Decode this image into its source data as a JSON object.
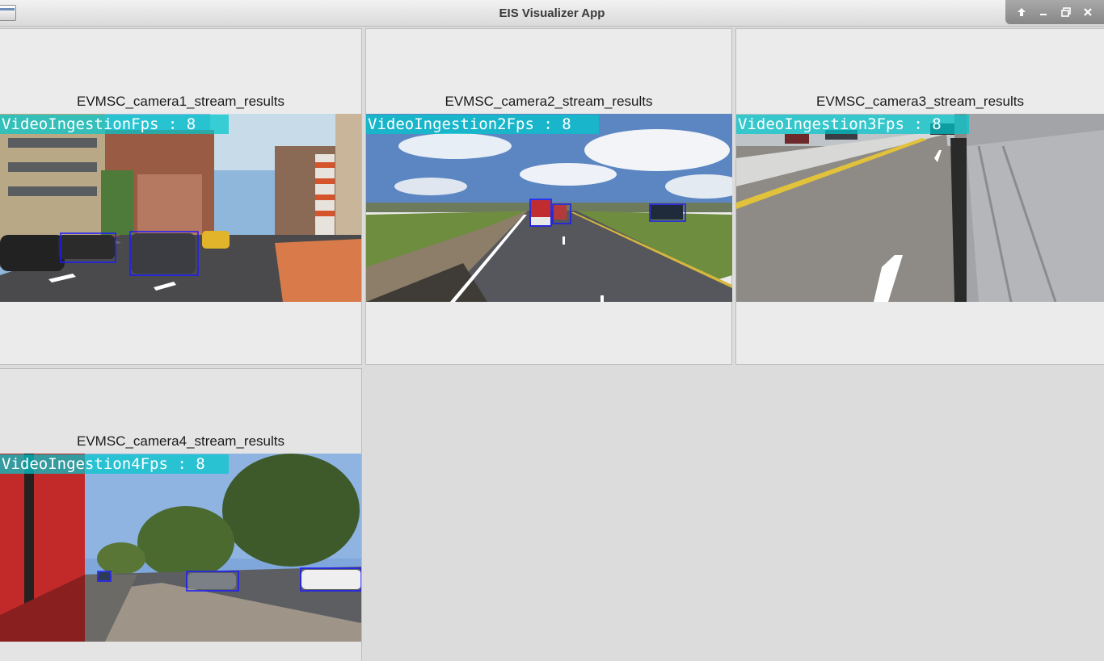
{
  "window": {
    "title": "EIS Visualizer App",
    "controls": [
      "pin-icon",
      "minimize-icon",
      "restore-icon",
      "close-icon"
    ]
  },
  "panels": [
    {
      "title": "EVMSC_camera1_stream_results",
      "fps_label": "VideoIngestionFps : 8"
    },
    {
      "title": "EVMSC_camera2_stream_results",
      "fps_label": "VideoIngestion2Fps : 8"
    },
    {
      "title": "EVMSC_camera3_stream_results",
      "fps_label": "VideoIngestion3Fps : 8"
    },
    {
      "title": "EVMSC_camera4_stream_results",
      "fps_label": "VideoIngestion4Fps : 8"
    }
  ],
  "colors": {
    "fps_overlay": "#00c8cd",
    "detection_box": "#1a1aff",
    "background": "#dcdcdc"
  }
}
